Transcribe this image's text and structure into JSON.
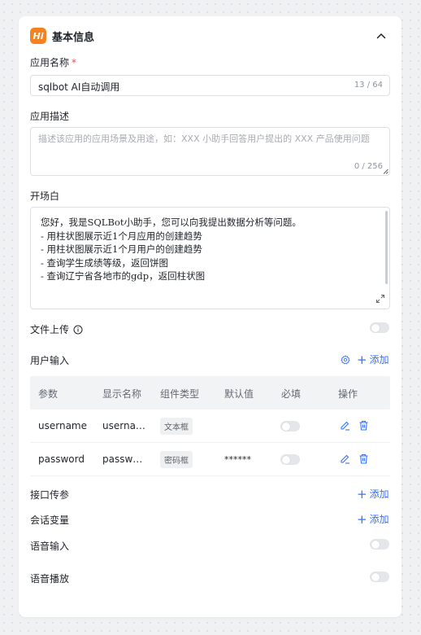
{
  "header": {
    "logo_text": "Hi",
    "title": "基本信息"
  },
  "app_name": {
    "label": "应用名称",
    "required_mark": "*",
    "value": "sqlbot AI自动调用",
    "counter": "13 / 64"
  },
  "app_desc": {
    "label": "应用描述",
    "placeholder": "描述该应用的应用场景及用途，如：XXX 小助手回答用户提出的 XXX 产品使用问题",
    "counter": "0 / 256"
  },
  "prologue": {
    "label": "开场白",
    "text": "您好，我是SQLBot小助手，您可以向我提出数据分析等问题。\n- 用柱状图展示近1个月应用的创建趋势\n- 用柱状图展示近1个月用户的创建趋势\n- 查询学生成绩等级，返回饼图\n- 查询辽宁省各地市的gdp，返回柱状图"
  },
  "file_upload": {
    "label": "文件上传",
    "enabled": false
  },
  "user_input": {
    "label": "用户输入",
    "add_label": "添加",
    "columns": [
      "参数",
      "显示名称",
      "组件类型",
      "默认值",
      "必填",
      "操作"
    ],
    "rows": [
      {
        "param": "username",
        "display": "userna…",
        "type": "文本框",
        "default": "",
        "required": false
      },
      {
        "param": "password",
        "display": "passw…",
        "type": "密码框",
        "default": "******",
        "required": false
      }
    ]
  },
  "api_params": {
    "label": "接口传参",
    "add_label": "添加"
  },
  "session_vars": {
    "label": "会话变量",
    "add_label": "添加"
  },
  "voice_input": {
    "label": "语音输入",
    "enabled": false
  },
  "voice_playback": {
    "label": "语音播放",
    "enabled": false
  },
  "colors": {
    "accent": "#3370ff",
    "logo": "#f58220",
    "required": "#f54a45"
  }
}
